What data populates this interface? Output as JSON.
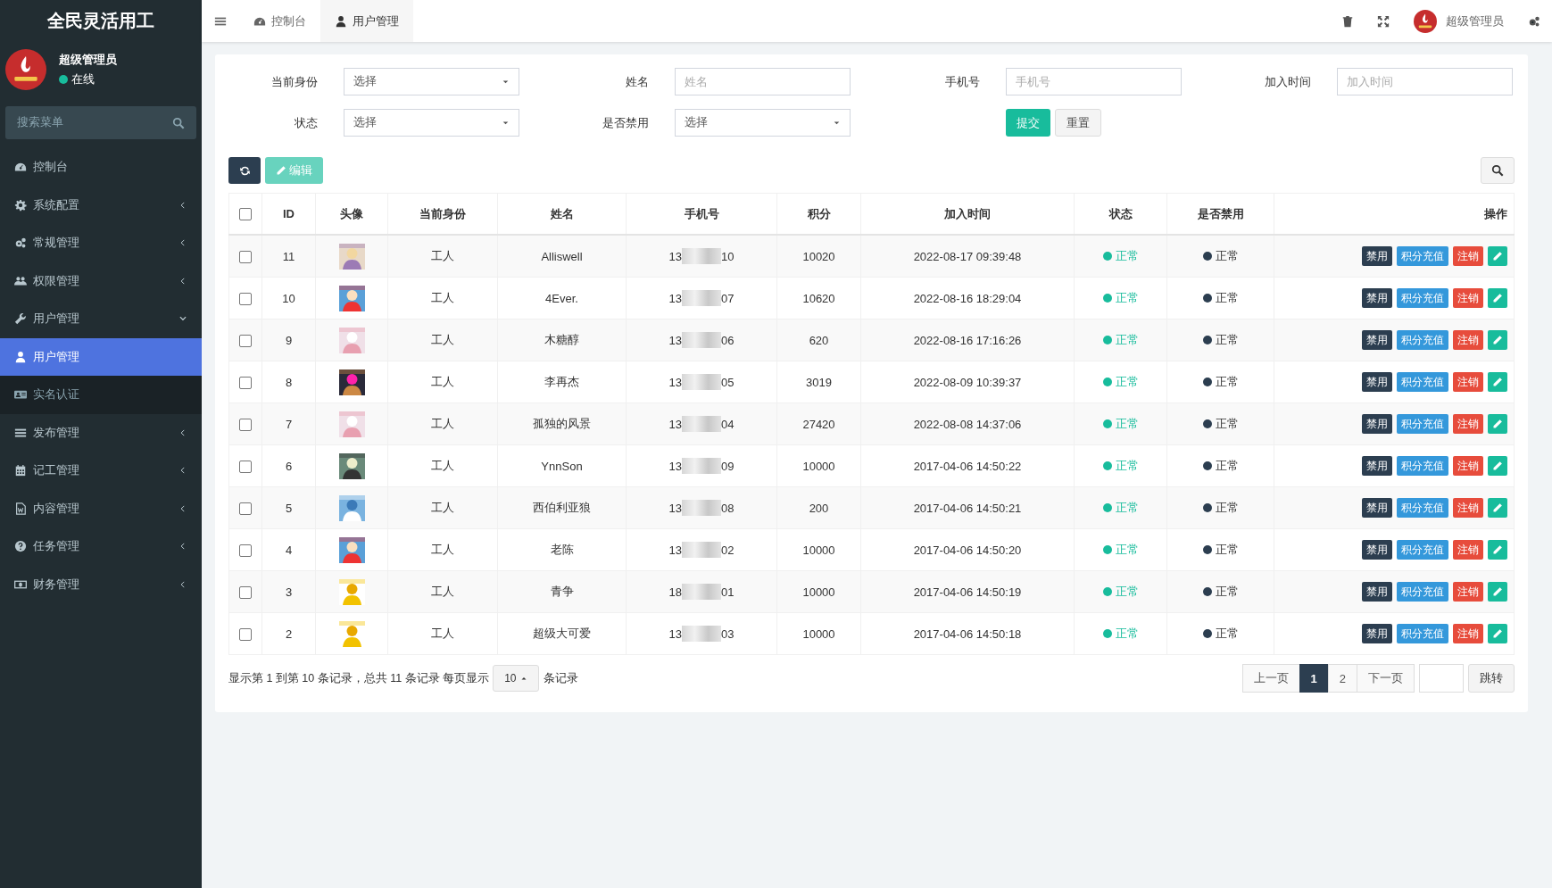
{
  "sidebar": {
    "brand": "全民灵活用工",
    "user": {
      "name": "超级管理员",
      "status": "在线",
      "online": true
    },
    "search": {
      "placeholder": "搜索菜单"
    },
    "items": [
      {
        "label": "控制台",
        "kind": "link",
        "selected": false
      },
      {
        "label": "系统配置",
        "kind": "menu",
        "expanded": false,
        "selected": false
      },
      {
        "label": "常规管理",
        "kind": "menu",
        "expanded": false,
        "selected": false
      },
      {
        "label": "权限管理",
        "kind": "menu",
        "expanded": false,
        "selected": false
      },
      {
        "label": "用户管理",
        "kind": "menu",
        "expanded": true,
        "selected": false,
        "children": [
          {
            "label": "用户管理",
            "selected": true
          },
          {
            "label": "实名认证",
            "selected": false
          }
        ]
      },
      {
        "label": "发布管理",
        "kind": "menu",
        "expanded": false,
        "selected": false
      },
      {
        "label": "记工管理",
        "kind": "menu",
        "expanded": false,
        "selected": false
      },
      {
        "label": "内容管理",
        "kind": "menu",
        "expanded": false,
        "selected": false
      },
      {
        "label": "任务管理",
        "kind": "menu",
        "expanded": false,
        "selected": false
      },
      {
        "label": "财务管理",
        "kind": "menu",
        "expanded": false,
        "selected": false
      }
    ]
  },
  "header": {
    "tabs": [
      {
        "label": "控制台",
        "selected": false
      },
      {
        "label": "用户管理",
        "selected": true
      }
    ],
    "user_name": "超级管理员"
  },
  "filters": [
    {
      "label": "当前身份",
      "kind": "select",
      "value": "选择"
    },
    {
      "label": "姓名",
      "kind": "text",
      "placeholder": "姓名"
    },
    {
      "label": "手机号",
      "kind": "text",
      "placeholder": "手机号"
    },
    {
      "label": "加入时间",
      "kind": "text",
      "placeholder": "加入时间"
    },
    {
      "label": "状态",
      "kind": "select",
      "value": "选择"
    },
    {
      "label": "是否禁用",
      "kind": "select",
      "value": "选择"
    }
  ],
  "filter_buttons": [
    "提交",
    "重置"
  ],
  "toolbar": {
    "edit": {
      "label": "编辑",
      "disabled": true
    }
  },
  "table": {
    "select_all_checked": false,
    "columns": [
      "ID",
      "头像",
      "当前身份",
      "姓名",
      "手机号",
      "积分",
      "加入时间",
      "状态",
      "是否禁用",
      "操作"
    ],
    "rows": [
      {
        "checked": false,
        "id": "11",
        "role": "工人",
        "name": "Alliswell",
        "phone_start": "13",
        "phone_end": "10",
        "points": "10020",
        "joined": "2022-08-17 09:39:48",
        "status": "正常",
        "ban": "正常",
        "actions": [
          "禁用",
          "积分充值",
          "注销"
        ]
      },
      {
        "checked": false,
        "id": "10",
        "role": "工人",
        "name": "4Ever.",
        "phone_start": "13",
        "phone_end": "07",
        "points": "10620",
        "joined": "2022-08-16 18:29:04",
        "status": "正常",
        "ban": "正常",
        "actions": [
          "禁用",
          "积分充值",
          "注销"
        ]
      },
      {
        "checked": false,
        "id": "9",
        "role": "工人",
        "name": "木糖醇",
        "phone_start": "13",
        "phone_end": "06",
        "points": "620",
        "joined": "2022-08-16 17:16:26",
        "status": "正常",
        "ban": "正常",
        "actions": [
          "禁用",
          "积分充值",
          "注销"
        ]
      },
      {
        "checked": false,
        "id": "8",
        "role": "工人",
        "name": "李再杰",
        "phone_start": "13",
        "phone_end": "05",
        "points": "3019",
        "joined": "2022-08-09 10:39:37",
        "status": "正常",
        "ban": "正常",
        "actions": [
          "禁用",
          "积分充值",
          "注销"
        ]
      },
      {
        "checked": false,
        "id": "7",
        "role": "工人",
        "name": "孤独的风景",
        "phone_start": "13",
        "phone_end": "04",
        "points": "27420",
        "joined": "2022-08-08 14:37:06",
        "status": "正常",
        "ban": "正常",
        "actions": [
          "禁用",
          "积分充值",
          "注销"
        ]
      },
      {
        "checked": false,
        "id": "6",
        "role": "工人",
        "name": "YnnSon",
        "phone_start": "13",
        "phone_end": "09",
        "points": "10000",
        "joined": "2017-04-06 14:50:22",
        "status": "正常",
        "ban": "正常",
        "actions": [
          "禁用",
          "积分充值",
          "注销"
        ]
      },
      {
        "checked": false,
        "id": "5",
        "role": "工人",
        "name": "西伯利亚狼",
        "phone_start": "13",
        "phone_end": "08",
        "points": "200",
        "joined": "2017-04-06 14:50:21",
        "status": "正常",
        "ban": "正常",
        "actions": [
          "禁用",
          "积分充值",
          "注销"
        ]
      },
      {
        "checked": false,
        "id": "4",
        "role": "工人",
        "name": "老陈",
        "phone_start": "13",
        "phone_end": "02",
        "points": "10000",
        "joined": "2017-04-06 14:50:20",
        "status": "正常",
        "ban": "正常",
        "actions": [
          "禁用",
          "积分充值",
          "注销"
        ]
      },
      {
        "checked": false,
        "id": "3",
        "role": "工人",
        "name": "青争",
        "phone_start": "18",
        "phone_end": "01",
        "points": "10000",
        "joined": "2017-04-06 14:50:19",
        "status": "正常",
        "ban": "正常",
        "actions": [
          "禁用",
          "积分充值",
          "注销"
        ]
      },
      {
        "checked": false,
        "id": "2",
        "role": "工人",
        "name": "超级大可爱",
        "phone_start": "13",
        "phone_end": "03",
        "points": "10000",
        "joined": "2017-04-06 14:50:18",
        "status": "正常",
        "ban": "正常",
        "actions": [
          "禁用",
          "积分充值",
          "注销"
        ]
      }
    ]
  },
  "pager": {
    "summary": "显示第 1 到第 10 条记录，总共 11 条记录 每页显示",
    "page_size": "10",
    "summary_tail": "条记录",
    "prev": "上一页",
    "pages": [
      {
        "label": "1",
        "selected": true
      },
      {
        "label": "2",
        "selected": false
      }
    ],
    "next": "下一页",
    "jump": "跳转"
  }
}
